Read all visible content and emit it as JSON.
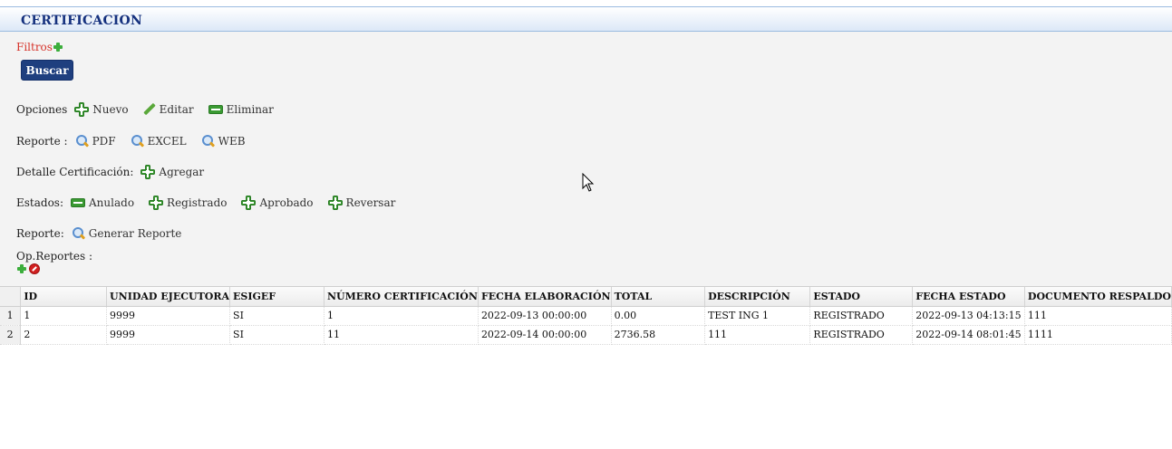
{
  "page": {
    "title": "CERTIFICACION"
  },
  "filters": {
    "label": "Filtros",
    "search_button": "Buscar"
  },
  "toolbar": {
    "opciones": {
      "label": "Opciones",
      "nuevo": "Nuevo",
      "editar": "Editar",
      "eliminar": "Eliminar"
    },
    "reporte": {
      "label": "Reporte :",
      "pdf": "PDF",
      "excel": "EXCEL",
      "web": "WEB"
    },
    "detalle": {
      "label": "Detalle Certificación:",
      "agregar": "Agregar"
    },
    "estados": {
      "label": "Estados:",
      "anulado": "Anulado",
      "registrado": "Registrado",
      "aprobado": "Aprobado",
      "reversar": "Reversar"
    },
    "reporte2": {
      "label": "Reporte:",
      "generar": "Generar Reporte"
    },
    "opreportes": {
      "label": "Op.Reportes :"
    }
  },
  "table": {
    "columns": [
      "ID",
      "UNIDAD EJECUTORA",
      "ESIGEF",
      "NÚMERO CERTIFICACIÓN",
      "FECHA ELABORACIÓN",
      "TOTAL",
      "DESCRIPCIÓN",
      "ESTADO",
      "FECHA ESTADO",
      "DOCUMENTO RESPALDO"
    ],
    "rows": [
      {
        "n": "1",
        "cells": [
          "1",
          "9999",
          "SI",
          "1",
          "2022-09-13 00:00:00",
          "0.00",
          "TEST ING 1",
          "REGISTRADO",
          "2022-09-13 04:13:15",
          "111"
        ]
      },
      {
        "n": "2",
        "cells": [
          "2",
          "9999",
          "SI",
          "11",
          "2022-09-14 00:00:00",
          "2736.58",
          "111",
          "REGISTRADO",
          "2022-09-14 08:01:45",
          "1111"
        ]
      }
    ]
  }
}
